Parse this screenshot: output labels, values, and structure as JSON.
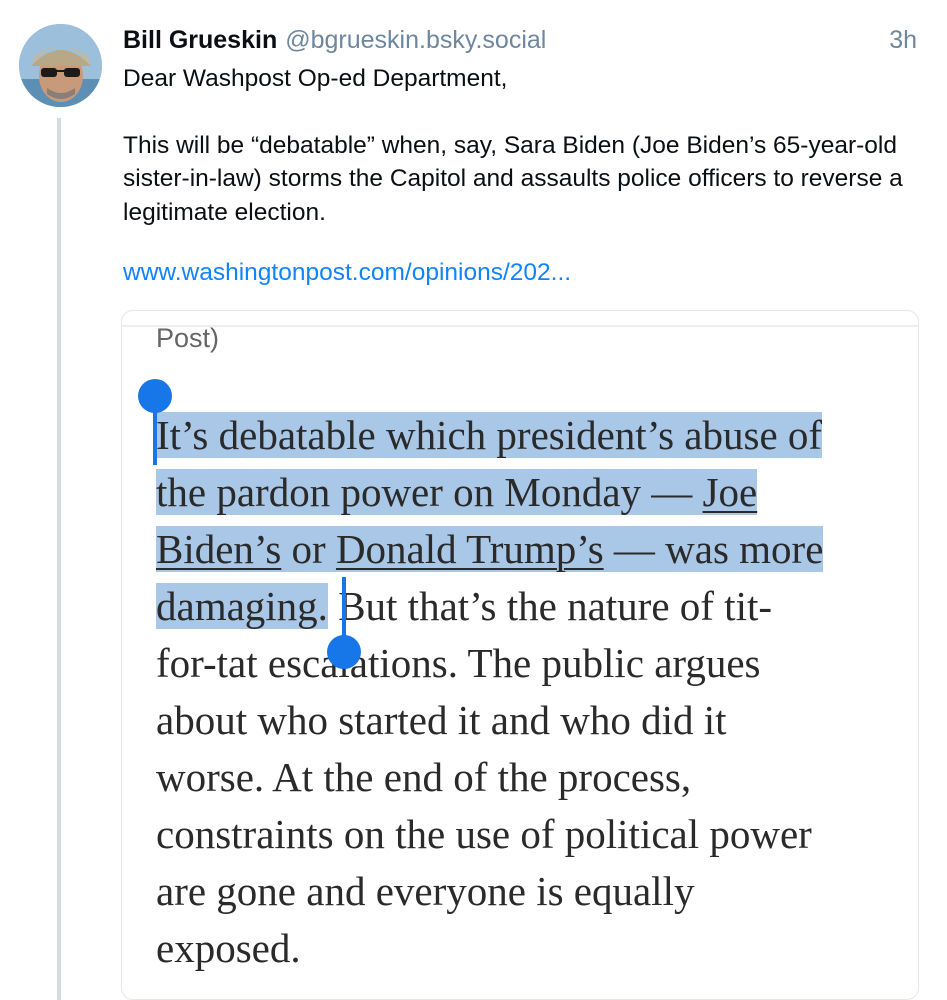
{
  "post": {
    "author_name": "Bill Grueskin",
    "author_handle": "@bgrueskin.bsky.social",
    "timestamp": "3h",
    "paragraphs": [
      "Dear Washpost Op-ed Department,",
      "This will be “debatable” when, say, Sara Biden (Joe Biden’s 65-year-old sister-in-law) storms the Capitol and assaults police officers to reverse a legitimate election."
    ],
    "link_text": "www.washingtonpost.com/opinions/202..."
  },
  "embed": {
    "snippet_top": "Post)",
    "lines": {
      "l1": "It’s debatable which president’s abuse of",
      "l2": "the pardon power on Monday — ",
      "l2_link": "Joe",
      "l3_link_a": "Biden’s",
      "l3_mid": " or ",
      "l3_link_b": "Donald Trump’s",
      "l3_end": " — was more",
      "l4_sel": "damaging.",
      "l4_rest": " But that’s the nature of tit-",
      "l5": "for-tat escalations. The public argues",
      "l6": "about who started it and who did it",
      "l7": "worse. At the end of the process,",
      "l8": "constraints on the use of political power",
      "l9": "are gone and everyone is equally",
      "l10": "exposed."
    }
  },
  "colors": {
    "link": "#1083fe",
    "handle_meta": "#6f869f",
    "selection_highlight": "#a9c7e6",
    "selection_handle": "#1776e8",
    "thread_line": "#d4dbe2"
  },
  "icons": {
    "avatar": "avatar-photo",
    "selection_handles": "text-selection-handle-icon"
  }
}
